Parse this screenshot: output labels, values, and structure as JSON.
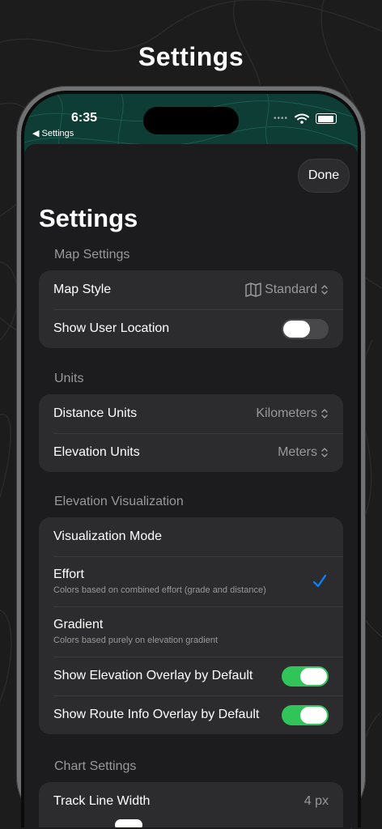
{
  "promo_title": "Settings",
  "status_bar": {
    "time": "6:35",
    "back_label": "◀ Settings"
  },
  "sheet": {
    "done_label": "Done",
    "title": "Settings"
  },
  "sections": {
    "map": {
      "header": "Map Settings",
      "map_style": {
        "label": "Map Style",
        "value": "Standard"
      },
      "show_user_location": {
        "label": "Show User Location",
        "enabled": false
      }
    },
    "units": {
      "header": "Units",
      "distance": {
        "label": "Distance Units",
        "value": "Kilometers"
      },
      "elevation": {
        "label": "Elevation Units",
        "value": "Meters"
      }
    },
    "elevation_viz": {
      "header": "Elevation Visualization",
      "mode_label": "Visualization Mode",
      "effort": {
        "title": "Effort",
        "subtitle": "Colors based on combined effort (grade and distance)",
        "selected": true
      },
      "gradient": {
        "title": "Gradient",
        "subtitle": "Colors based purely on elevation gradient",
        "selected": false
      },
      "show_elevation_overlay": {
        "label": "Show Elevation Overlay by Default",
        "enabled": true
      },
      "show_route_info_overlay": {
        "label": "Show Route Info Overlay by Default",
        "enabled": true
      }
    },
    "chart": {
      "header": "Chart Settings",
      "track_line_width": {
        "label": "Track Line Width",
        "value": "4 px"
      }
    }
  },
  "colors": {
    "accent_check": "#0a84ff",
    "toggle_on": "#30c45a",
    "toggle_off": "#48484a",
    "row_background": "#2c2c2e",
    "sheet_background": "#1c1c1e"
  },
  "icons": {
    "map_style": "map-icon",
    "chevron": "chevron-up-down-icon",
    "check": "checkmark-icon",
    "wifi": "wifi-icon",
    "battery": "battery-icon"
  }
}
